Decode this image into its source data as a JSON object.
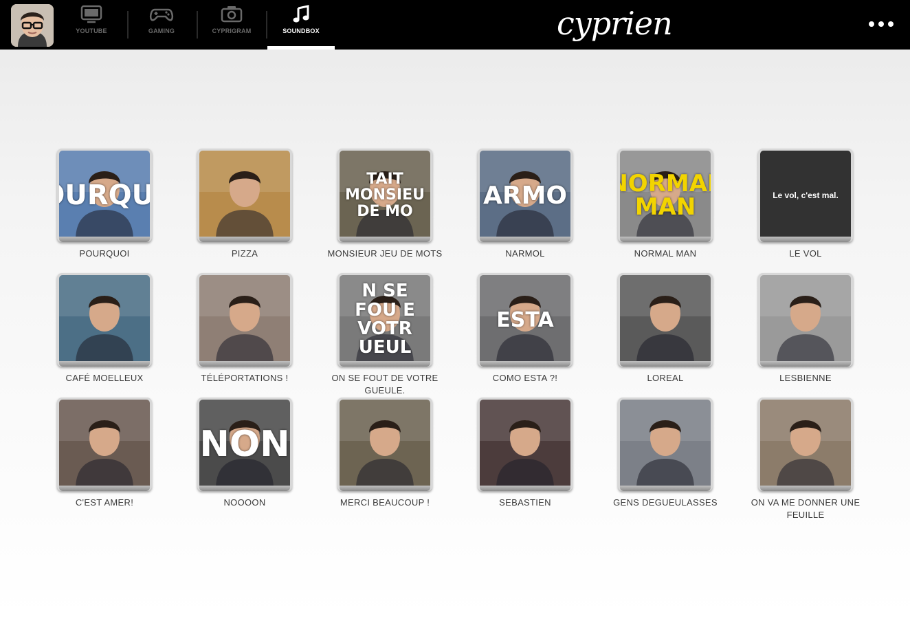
{
  "header": {
    "brand": "cyprien",
    "tabs": [
      {
        "label": "YOUTUBE",
        "icon": "tv-icon",
        "active": false
      },
      {
        "label": "GAMING",
        "icon": "gamepad-icon",
        "active": false
      },
      {
        "label": "CYPRIGRAM",
        "icon": "camera-icon",
        "active": false
      },
      {
        "label": "SOUNDBOX",
        "icon": "music-note-icon",
        "active": true
      }
    ],
    "more_icon": "more-horizontal-icon"
  },
  "soundbox": {
    "items": [
      {
        "label": "POURQUOI",
        "overlay": "POURQUOI",
        "bg": "#5a7fb0"
      },
      {
        "label": "PIZZA",
        "overlay": "",
        "bg": "#b88c4c"
      },
      {
        "label": "MONSIEUR JEU DE MOTS",
        "overlay": "TAIT MONSIEU DE MO",
        "bg": "#6b6452"
      },
      {
        "label": "NARMOL",
        "overlay": "ARMO",
        "bg": "#5c6e86"
      },
      {
        "label": "NORMAL MAN",
        "overlay": "NORMAL MAN",
        "bg": "#8a8a8a"
      },
      {
        "label": "LE VOL",
        "overlay": "Le vol, c'est mal.",
        "bg": "#323232"
      },
      {
        "label": "CAFÉ MOELLEUX",
        "overlay": "",
        "bg": "#4c6f86"
      },
      {
        "label": "TÉLÉPORTATIONS !",
        "overlay": "",
        "bg": "#8f7f75"
      },
      {
        "label": "ON SE FOUT DE VOTRE GUEULE.",
        "overlay": "N SE FOU E VOTR UEUL",
        "bg": "#7a7a7a"
      },
      {
        "label": "COMO ESTA ?!",
        "overlay": "ESTA",
        "bg": "#6e6e70"
      },
      {
        "label": "LOREAL",
        "overlay": "",
        "bg": "#5a5a5a"
      },
      {
        "label": "LESBIENNE",
        "overlay": "",
        "bg": "#9a9a9a"
      },
      {
        "label": "C'EST AMER!",
        "overlay": "",
        "bg": "#6a5b52"
      },
      {
        "label": "NOOOON",
        "overlay": "NON",
        "bg": "#4b4b4b"
      },
      {
        "label": "MERCI BEAUCOUP !",
        "overlay": "",
        "bg": "#6d6452"
      },
      {
        "label": "SEBASTIEN",
        "overlay": "",
        "bg": "#4c3c3c"
      },
      {
        "label": "GENS DEGUEULASSES",
        "overlay": "",
        "bg": "#7c8088"
      },
      {
        "label": "ON VA ME DONNER UNE FEUILLE",
        "overlay": "",
        "bg": "#8c7c6a"
      }
    ]
  }
}
